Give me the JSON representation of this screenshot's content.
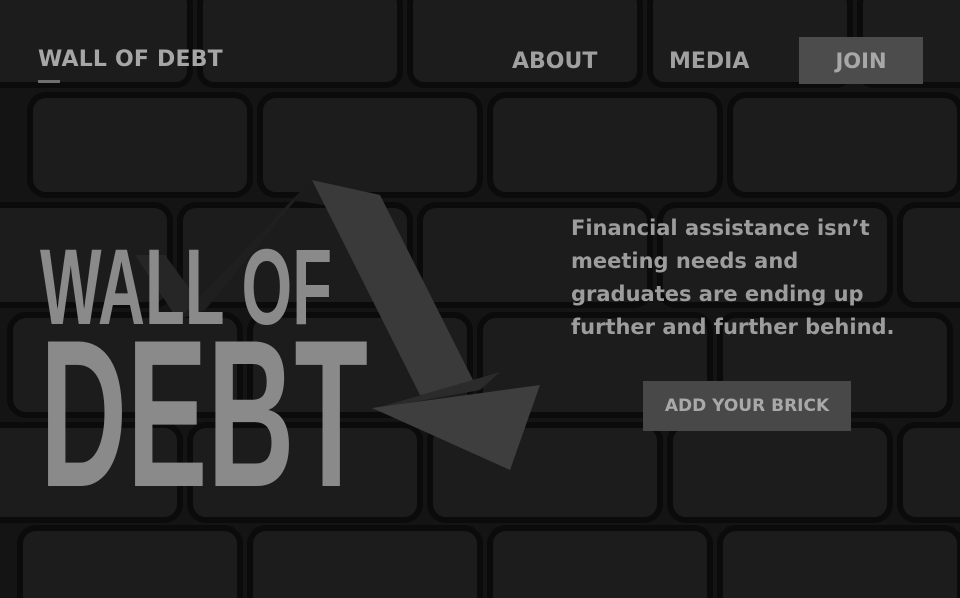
{
  "nav": {
    "logo": "WALL OF DEBT",
    "links": [
      {
        "label": "ABOUT"
      },
      {
        "label": "MEDIA"
      }
    ],
    "join_label": "JOIN"
  },
  "hero": {
    "title_line1": "WALL OF",
    "title_line2": "DEBT",
    "tagline_lines": [
      "Financial assistance isn’t",
      "meeting needs and",
      "graduates are ending up",
      "further and further behind."
    ],
    "cta_label": "ADD YOUR BRICK"
  },
  "icons": {
    "arrow": "downward-trend-arrow-icon",
    "background": "brick-wall-background"
  },
  "colors": {
    "background": "#151515",
    "text": "#a0a0a0",
    "button": "#4c4c4c",
    "hero_text": "#8a8a8a"
  }
}
